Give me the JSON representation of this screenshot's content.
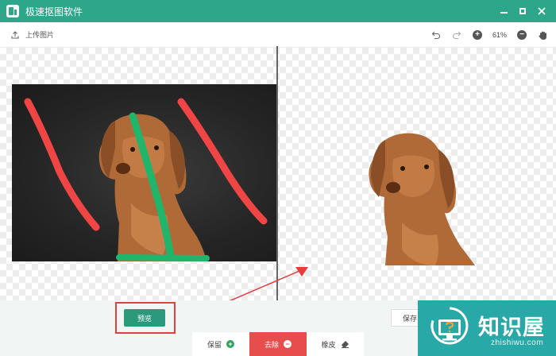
{
  "app": {
    "title": "极速抠图软件"
  },
  "window_controls": [
    "minimize-icon",
    "maximize-icon",
    "close-icon"
  ],
  "toolbar": {
    "upload_label": "上传图片",
    "zoom_level": "61%",
    "icons": [
      "undo-icon",
      "redo-icon",
      "zoom-in-icon",
      "zoom-out-icon",
      "hand-pan-icon"
    ]
  },
  "editor": {
    "preview_label": "预览",
    "save_label": "保存"
  },
  "tools": [
    {
      "label": "保留",
      "icon": "plus-circle-icon",
      "color": "#2ea35f",
      "active": false
    },
    {
      "label": "去除",
      "icon": "minus-circle-icon",
      "color": "#ffffff",
      "active": true
    },
    {
      "label": "橡皮",
      "icon": "eraser-icon",
      "color": "#555555",
      "active": false
    }
  ],
  "watermark": {
    "title": "知识屋",
    "subtitle": "zhishiwu.com"
  },
  "colors": {
    "titlebar": "#2ea689",
    "keep_stroke": "#1fb56a",
    "remove_stroke": "#f04545",
    "active_tool": "#e84d4d",
    "preview_button": "#2b9a7c",
    "highlight_frame": "#e04040",
    "watermark_bg": "#28a8a6"
  }
}
